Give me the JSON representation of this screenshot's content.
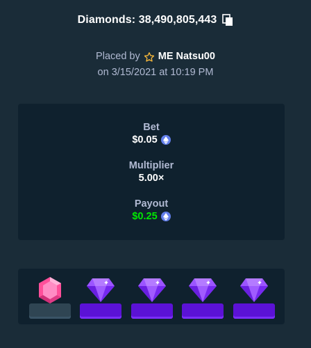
{
  "header": {
    "title": "Diamonds: 38,490,805,443",
    "copy_icon": "copy-icon"
  },
  "placed": {
    "prefix": "Placed by",
    "star_icon": "star-icon",
    "username": "ME Natsu00",
    "date_line": "on 3/15/2021 at 10:19 PM"
  },
  "bet": {
    "label": "Bet",
    "value": "$0.05",
    "currency_icon": "eth-icon"
  },
  "multiplier": {
    "label": "Multiplier",
    "value": "5.00×"
  },
  "payout": {
    "label": "Payout",
    "value": "$0.25",
    "currency_icon": "eth-icon",
    "color": "#00e701"
  },
  "tiles": [
    {
      "gem": "pink-ruby",
      "color": "#ff5ea8"
    },
    {
      "gem": "purple-diamond",
      "color": "#8b3dff"
    },
    {
      "gem": "purple-diamond",
      "color": "#8b3dff"
    },
    {
      "gem": "purple-diamond",
      "color": "#8b3dff"
    },
    {
      "gem": "purple-diamond",
      "color": "#8b3dff"
    }
  ],
  "colors": {
    "background": "#1a2c38",
    "panel": "#0f212e",
    "muted_text": "#b1bad3",
    "accent_green": "#00e701",
    "gem_base": "#5b12d6"
  }
}
